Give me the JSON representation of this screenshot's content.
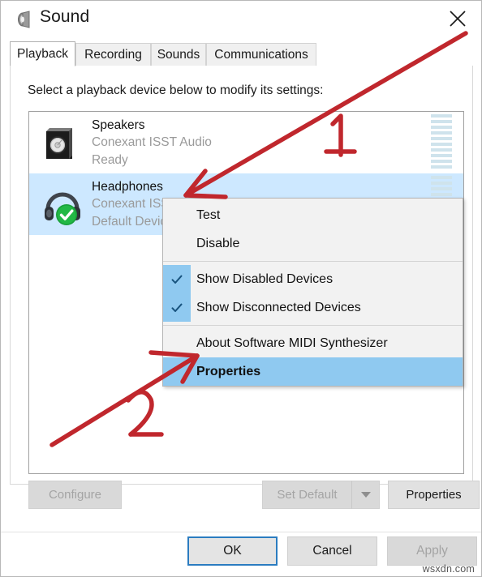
{
  "window": {
    "title": "Sound",
    "icon": "speaker-icon",
    "close_label": "✕"
  },
  "tabs": [
    {
      "label": "Playback",
      "active": true
    },
    {
      "label": "Recording",
      "active": false
    },
    {
      "label": "Sounds",
      "active": false
    },
    {
      "label": "Communications",
      "active": false
    }
  ],
  "playback": {
    "hint": "Select a playback device below to modify its settings:",
    "devices": [
      {
        "name": "Speakers",
        "driver": "Conexant ISST Audio",
        "status": "Ready",
        "icon": "speaker-box-icon",
        "selected": false,
        "badge": "",
        "meter_segments": 10,
        "meter_active": 0
      },
      {
        "name": "Headphones",
        "driver": "Conexant ISST",
        "status": "Default Device",
        "icon": "headphones-icon",
        "selected": true,
        "badge": "green-check-badge",
        "meter_segments": 10,
        "meter_active": 0
      }
    ]
  },
  "panel_buttons": {
    "configure": {
      "label": "Configure",
      "enabled": false
    },
    "set_default": {
      "label": "Set Default",
      "enabled": false
    },
    "set_default_arrow": {
      "icon": "chevron-down-icon",
      "enabled": false
    },
    "properties": {
      "label": "Properties",
      "enabled": true
    }
  },
  "footer_buttons": {
    "ok": {
      "label": "OK",
      "enabled": true,
      "default": true
    },
    "cancel": {
      "label": "Cancel",
      "enabled": true
    },
    "apply": {
      "label": "Apply",
      "enabled": false
    }
  },
  "context_menu": {
    "items": [
      {
        "label": "Test",
        "checked": false,
        "highlighted": false,
        "separator_after": false
      },
      {
        "label": "Disable",
        "checked": false,
        "highlighted": false,
        "separator_after": true
      },
      {
        "label": "Show Disabled Devices",
        "checked": true,
        "highlighted": false,
        "separator_after": false
      },
      {
        "label": "Show Disconnected Devices",
        "checked": true,
        "highlighted": false,
        "separator_after": true
      },
      {
        "label": "About Software MIDI Synthesizer",
        "checked": false,
        "highlighted": false,
        "separator_after": false
      },
      {
        "label": "Properties",
        "checked": false,
        "highlighted": true,
        "separator_after": false
      }
    ]
  },
  "annotations": {
    "color": "#c0272d",
    "step_one": "1",
    "step_two": "2"
  },
  "watermark": "wsxdn.com",
  "colors": {
    "selection_blue": "#cde8ff",
    "menu_highlight": "#8fc9f0",
    "accent_border": "#2b7cc0",
    "annotation_red": "#c0272d",
    "meter_segment": "#cfe3ec"
  }
}
